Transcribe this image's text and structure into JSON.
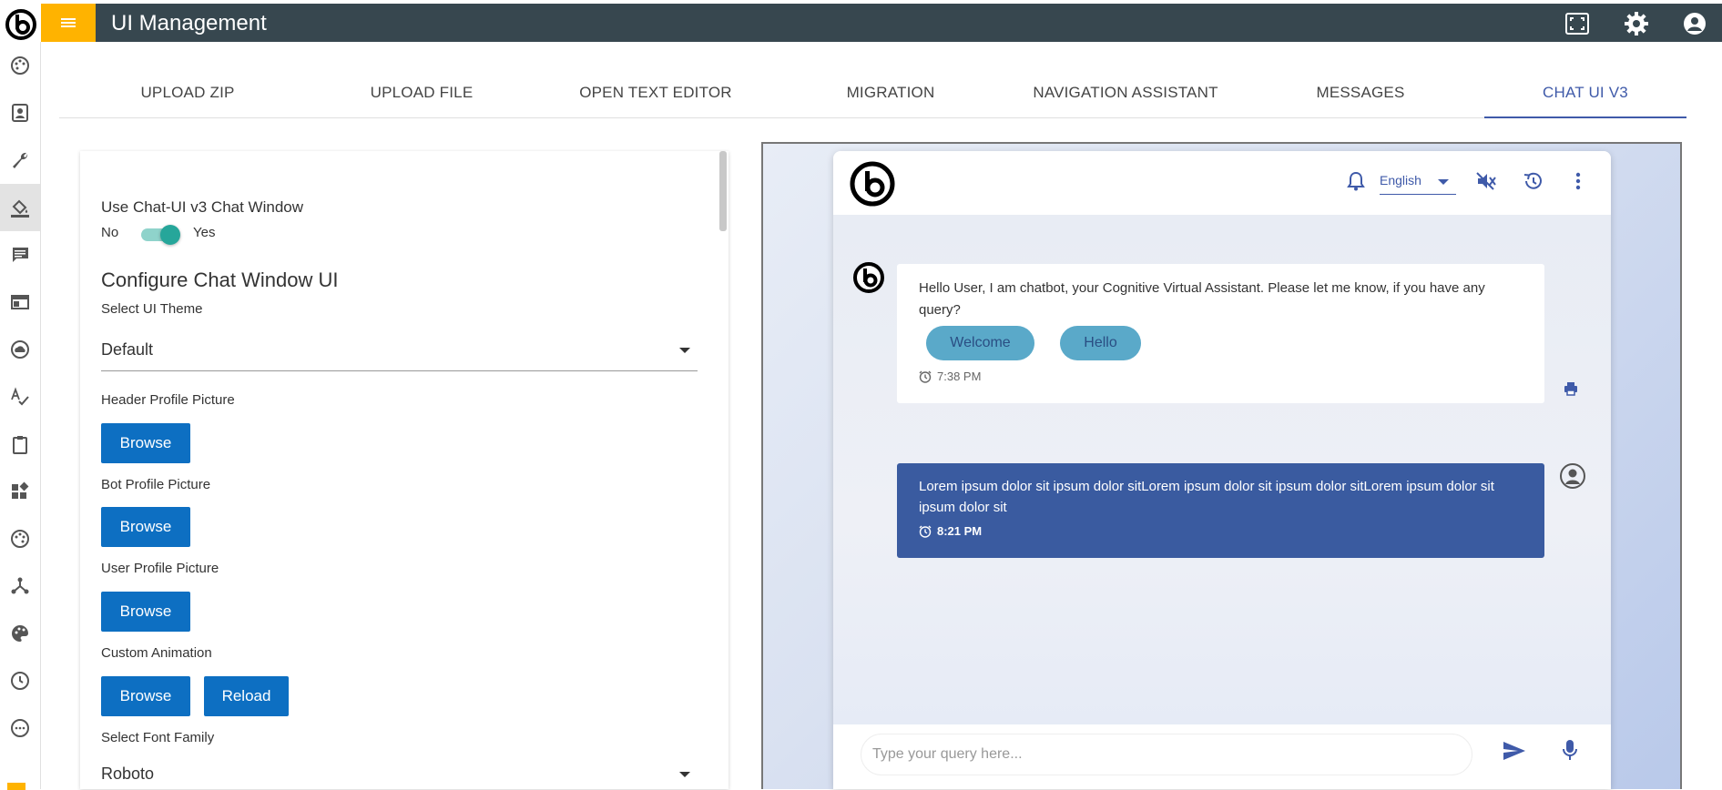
{
  "app": {
    "title": "UI Management"
  },
  "topbar_icons": [
    "fullscreen-icon",
    "gear-icon",
    "account-icon"
  ],
  "sidebar": {
    "items": [
      "palette-icon",
      "contact-icon",
      "wrench-icon",
      "paint-bucket-icon",
      "chat-icon",
      "window-icon",
      "cloud-icon",
      "spellcheck-icon",
      "clipboard-icon",
      "widgets-icon",
      "palette-icon-2",
      "hub-icon",
      "color-palette-icon",
      "clock-icon",
      "emoji-icon"
    ],
    "active_index": 3
  },
  "tabs": [
    {
      "label": "UPLOAD ZIP"
    },
    {
      "label": "UPLOAD FILE"
    },
    {
      "label": "OPEN TEXT EDITOR"
    },
    {
      "label": "MIGRATION"
    },
    {
      "label": "NAVIGATION ASSISTANT"
    },
    {
      "label": "MESSAGES"
    },
    {
      "label": "CHAT UI V3"
    }
  ],
  "config": {
    "use_chat_label": "Use Chat-UI v3 Chat Window",
    "toggle_no": "No",
    "toggle_yes": "Yes",
    "heading": "Configure Chat Window UI",
    "theme_label": "Select UI Theme",
    "theme_value": "Default",
    "header_pic_label": "Header Profile Picture",
    "bot_pic_label": "Bot Profile Picture",
    "user_pic_label": "User Profile Picture",
    "custom_anim_label": "Custom Animation",
    "browse_label": "Browse",
    "reload_label": "Reload",
    "font_label": "Select Font Family",
    "font_value": "Roboto"
  },
  "chat": {
    "language": "English",
    "bot_message": "Hello User, I am chatbot, your Cognitive Virtual Assistant. Please let me know, if you have any query?",
    "chips": [
      "Welcome",
      "Hello"
    ],
    "bot_time": "7:38 PM",
    "user_message": "Lorem ipsum dolor sit ipsum dolor sitLorem ipsum dolor sit ipsum dolor sitLorem ipsum dolor sit ipsum dolor sit",
    "user_time": "8:21 PM",
    "input_placeholder": "Type your query here..."
  },
  "colors": {
    "topbar": "#37474f",
    "menu_accent": "#ffb300",
    "primary_button": "#0d6fc2",
    "active_tab": "#3f5aa9",
    "user_bubble": "#3a5ba0",
    "chip": "#5aa9c9",
    "toggle": "#26a69a"
  }
}
